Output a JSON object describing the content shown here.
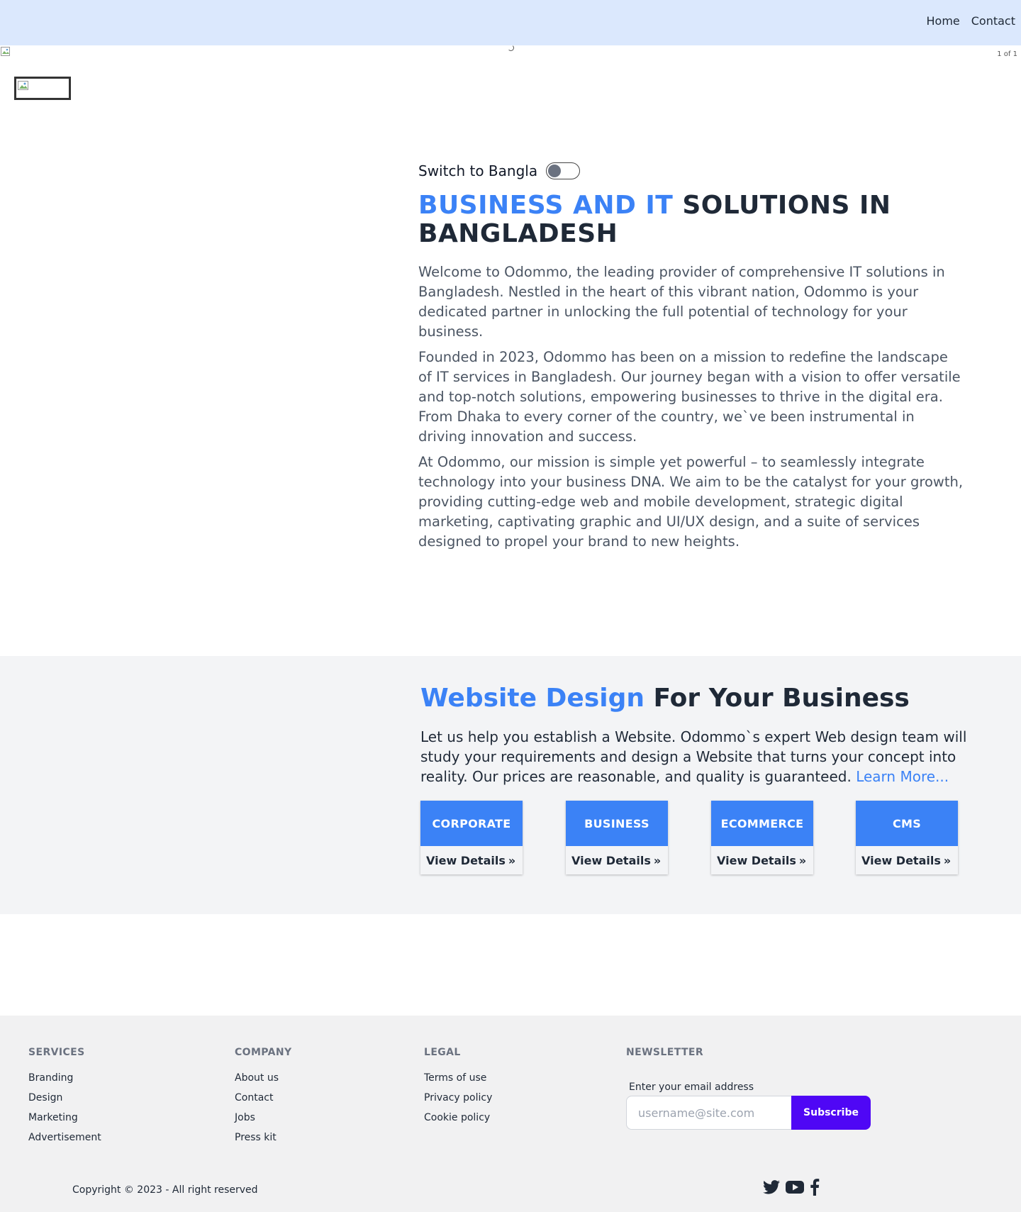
{
  "nav": {
    "home": "Home",
    "contact": "Contact"
  },
  "slider": {
    "counter": "1 of 1"
  },
  "hero": {
    "switch_label": "Switch to Bangla",
    "title_accent": "BUSINESS AND IT",
    "title_rest": " SOLUTIONS IN BANGLADESH",
    "paragraphs": [
      "Welcome to Odommo, the leading provider of comprehensive IT solutions in Bangladesh. Nestled in the heart of this vibrant nation, Odommo is your dedicated partner in unlocking the full potential of technology for your business.",
      "Founded in 2023, Odommo has been on a mission to redefine the landscape of IT services in Bangladesh. Our journey began with a vision to offer versatile and top-notch solutions, empowering businesses to thrive in the digital era. From Dhaka to every corner of the country, we`ve been instrumental in driving innovation and success.",
      "At Odommo, our mission is simple yet powerful – to seamlessly integrate technology into your business DNA. We aim to be the catalyst for your growth, providing cutting-edge web and mobile development, strategic digital marketing, captivating graphic and UI/UX design, and a suite of services designed to propel your brand to new heights."
    ]
  },
  "website_design": {
    "title_accent": "Website Design",
    "title_rest": " For Your Business",
    "description": "Let us help you establish a Website. Odommo`s expert Web design team will study your requirements and design a Website that turns your concept into reality. Our prices are reasonable, and quality is guaranteed. ",
    "learn_more": "Learn More...",
    "cards": [
      {
        "title": "CORPORATE",
        "link": "View Details"
      },
      {
        "title": "BUSINESS",
        "link": "View Details"
      },
      {
        "title": "ECOMMERCE",
        "link": "View Details"
      },
      {
        "title": "CMS",
        "link": "View Details"
      }
    ],
    "chevron": "»"
  },
  "footer": {
    "services": {
      "heading": "SERVICES",
      "items": [
        "Branding",
        "Design",
        "Marketing",
        "Advertisement"
      ]
    },
    "company": {
      "heading": "COMPANY",
      "items": [
        "About us",
        "Contact",
        "Jobs",
        "Press kit"
      ]
    },
    "legal": {
      "heading": "LEGAL",
      "items": [
        "Terms of use",
        "Privacy policy",
        "Cookie policy"
      ]
    },
    "newsletter": {
      "heading": "NEWSLETTER",
      "label": "Enter your email address",
      "placeholder": "username@site.com",
      "button": "Subscribe"
    },
    "copyright": "Copyright © 2023 - All right reserved",
    "social_icons": [
      "twitter-icon",
      "youtube-icon",
      "facebook-icon"
    ]
  },
  "colors": {
    "accent": "#3b82f6",
    "nav_bg": "#dbe8fd",
    "subscribe": "#4f07f5",
    "section_bg": "#f3f4f6"
  }
}
